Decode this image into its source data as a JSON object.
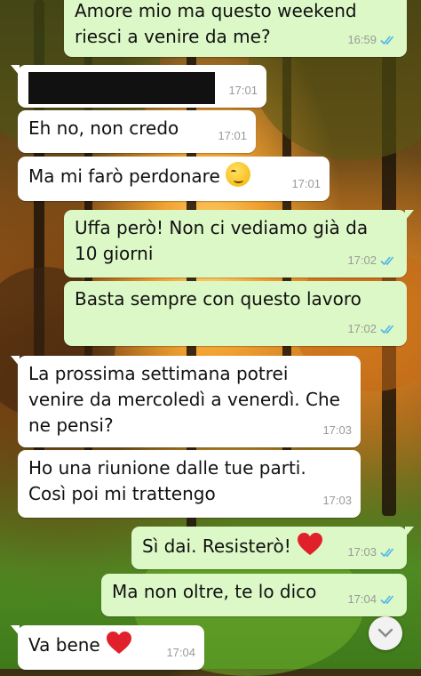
{
  "colors": {
    "incoming_bubble": "#ffffff",
    "outgoing_bubble": "#dcf8c6",
    "read_ticks": "#4fb6ec",
    "timestamp": "#9a9a9a",
    "heart": "#e0202a"
  },
  "messages": [
    {
      "dir": "out",
      "text": "Amore mio ma questo weekend\nriesci a venire da me?",
      "time": "16:59",
      "read": true
    },
    {
      "dir": "in",
      "text": "",
      "redacted": true,
      "time": "17:01"
    },
    {
      "dir": "in",
      "text": "Eh no, non credo",
      "time": "17:01"
    },
    {
      "dir": "in",
      "text": "Ma mi farò perdonare",
      "emoji": "smirking-face",
      "time": "17:01"
    },
    {
      "dir": "out",
      "text": "Uffa però! Non ci vediamo già da\n10 giorni",
      "time": "17:02",
      "read": true
    },
    {
      "dir": "out",
      "text": "Basta sempre con questo lavoro",
      "time": "17:02",
      "read": true
    },
    {
      "dir": "in",
      "text": "La prossima settimana potrei\nvenire da mercoledì a venerdì. Che\nne pensi?",
      "time": "17:03"
    },
    {
      "dir": "in",
      "text": "Ho una riunione dalle tue parti.\nCosì poi mi trattengo",
      "time": "17:03"
    },
    {
      "dir": "out",
      "text": "Sì dai. Resisterò!",
      "emoji": "red-heart",
      "time": "17:03",
      "read": true
    },
    {
      "dir": "out",
      "text": "Ma non oltre, te lo dico",
      "time": "17:04",
      "read": true
    },
    {
      "dir": "in",
      "text": "Va bene",
      "emoji": "red-heart",
      "time": "17:04"
    }
  ],
  "scroll_button": {
    "icon": "chevron-down-icon"
  }
}
